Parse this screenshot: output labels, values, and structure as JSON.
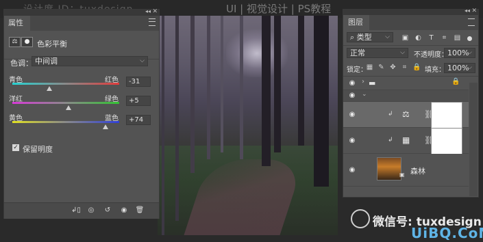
{
  "header": {
    "left_text": "设计度 ID：tuxdesign",
    "right_text": "UI | 视觉设计 | PS教程"
  },
  "properties_panel": {
    "tab_title": "属性",
    "section_title": "色彩平衡",
    "tone_label": "色调：",
    "tone_value": "中间调",
    "sliders": [
      {
        "left_label": "青色",
        "right_label": "红色",
        "value": "-31",
        "level": -31
      },
      {
        "left_label": "洋红",
        "right_label": "绿色",
        "value": "+5",
        "level": 5
      },
      {
        "left_label": "黄色",
        "right_label": "蓝色",
        "value": "+74",
        "level": 74
      }
    ],
    "preserve_luminosity_label": "保留明度",
    "preserve_luminosity_checked": true,
    "bottom_icons": [
      "clip-to-layer-icon",
      "view-previous-icon",
      "reset-icon",
      "visibility-icon",
      "trash-icon"
    ]
  },
  "layers_panel": {
    "tab_title": "图层",
    "filter_kind": "类型",
    "filter_icons": [
      "image-filter-icon",
      "adjustment-filter-icon",
      "type-filter-icon",
      "shape-filter-icon",
      "smart-object-filter-icon"
    ],
    "blend_mode": "正常",
    "opacity_label": "不透明度：",
    "opacity_value": "100%",
    "lock_label": "锁定：",
    "lock_icons": [
      "lock-pixels-icon",
      "lock-paint-icon",
      "lock-position-icon",
      "lock-artboard-icon",
      "lock-all-icon"
    ],
    "fill_label": "填充：",
    "fill_value": "100%",
    "layers": [
      {
        "type": "group",
        "name": ""
      },
      {
        "type": "adjustment",
        "name": ""
      },
      {
        "type": "adjustment",
        "name": ""
      },
      {
        "type": "image",
        "name": "森林"
      }
    ]
  },
  "watermark": {
    "wechat_text": "微信号: tuxdesign",
    "site_text": "UiBQ.CoM"
  },
  "colors": {
    "panel_bg": "#535353",
    "panel_header": "#383838",
    "selected_row": "#696969",
    "accent": "#5fb4e6"
  }
}
